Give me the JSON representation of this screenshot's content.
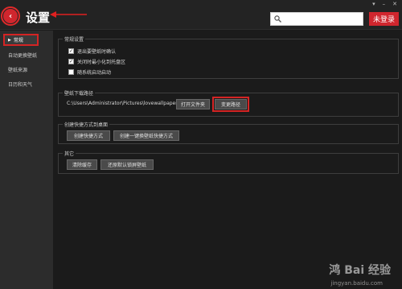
{
  "header": {
    "title": "设置",
    "search": {
      "value": "",
      "placeholder": ""
    },
    "login_label": "未登录",
    "window_controls": [
      "▾",
      "–",
      "✕"
    ]
  },
  "sidebar": {
    "items": [
      {
        "label": "常规",
        "active": true
      },
      {
        "label": "自动更换壁纸"
      },
      {
        "label": "壁纸来源"
      },
      {
        "label": "日历和天气"
      }
    ]
  },
  "main": {
    "general": {
      "title": "常规设置",
      "options": [
        {
          "label": "退出要壁纸时确认",
          "checked": true
        },
        {
          "label": "关闭时最小化到托盘区",
          "checked": true
        },
        {
          "label": "随系统启动启动",
          "checked": false
        }
      ]
    },
    "download_path": {
      "title": "壁纸下载路径",
      "path": "C:\\Users\\Administrator\\Pictures\\lovewallpaper",
      "open_folder_label": "打开文件夹",
      "change_path_label": "变更路径"
    },
    "shortcut": {
      "title": "创建快捷方式到桌面",
      "create_label": "创建快捷方式",
      "create_switch_label": "创建一键换壁纸快捷方式"
    },
    "other": {
      "title": "其它",
      "clear_cache_label": "清除缓存",
      "restore_lock_label": "还原默认锁屏壁纸"
    }
  },
  "watermark": {
    "text": "鸿 Bai 经验",
    "url": "jingyan.baidu.com"
  },
  "colors": {
    "accent": "#d0262e",
    "background": "#1b1b1b",
    "sidebar": "#2c2c2c"
  }
}
